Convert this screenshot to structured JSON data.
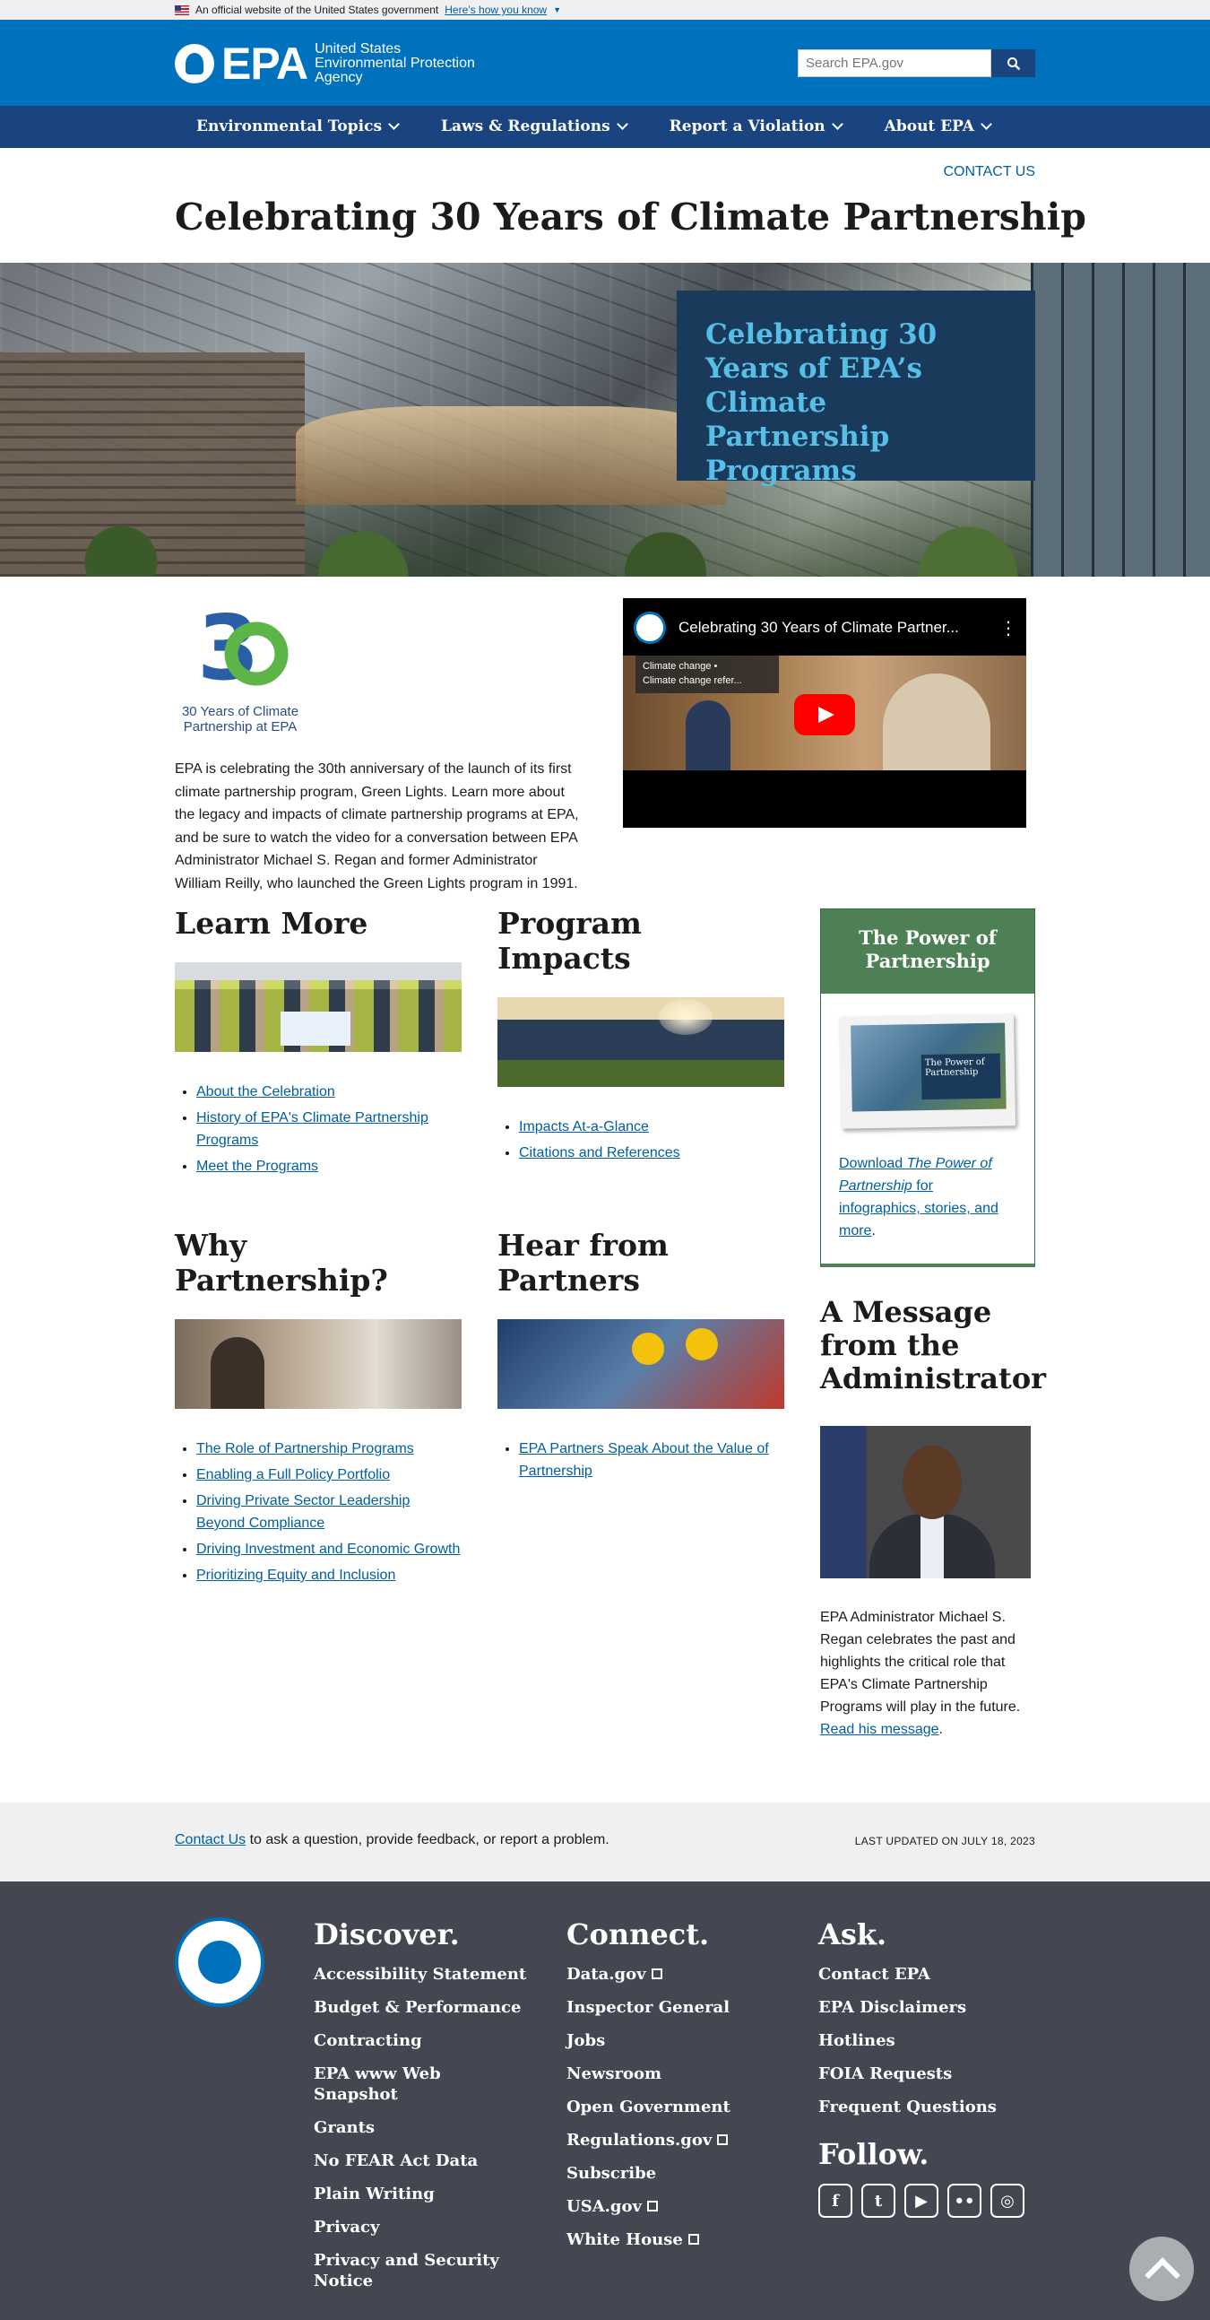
{
  "gov_banner": {
    "text": "An official website of the United States government",
    "link": "Here’s how you know"
  },
  "header": {
    "logo": "EPA",
    "logo_sub": [
      "United States",
      "Environmental Protection",
      "Agency"
    ],
    "search_placeholder": "Search EPA.gov"
  },
  "nav": [
    "Environmental Topics",
    "Laws & Regulations",
    "Report a Violation",
    "About EPA"
  ],
  "contact_link": "CONTACT US",
  "page_title": "Celebrating 30 Years of Climate Partnership",
  "hero_title": "Celebrating 30 Years of EPA’s Climate Partnership Programs",
  "badge": {
    "line1": "30 Years of Climate",
    "line2": "Partnership at EPA"
  },
  "intro": "EPA is celebrating the 30th anniversary of the launch of its first climate partnership program, Green Lights. Learn more about the legacy and impacts of climate partnership programs at EPA, and be sure to watch the video for a conversation between EPA Administrator Michael S. Regan and former Administrator William Reilly, who launched the Green Lights program in 1991.",
  "video": {
    "title": "Celebrating 30 Years of Climate Partner...",
    "playlist_1": "Climate change •",
    "playlist_2": "Climate change refer..."
  },
  "learn_more": {
    "title": "Learn More",
    "links": [
      "About the Celebration",
      "History of EPA's Climate Partnership Programs",
      "Meet the Programs"
    ]
  },
  "program_impacts": {
    "title": "Program Impacts",
    "links": [
      "Impacts At-a-Glance",
      "Citations and References"
    ]
  },
  "why_partnership": {
    "title": "Why Partnership?",
    "links": [
      "The Role of Partnership Programs",
      "Enabling a Full Policy Portfolio",
      "Driving Private Sector Leadership Beyond Compliance",
      "Driving Investment and Economic Growth",
      "Prioritizing Equity and Inclusion"
    ]
  },
  "hear_partners": {
    "title": "Hear from Partners",
    "links": [
      "EPA Partners Speak About the Value of Partnership"
    ]
  },
  "power": {
    "title": "The Power of Partnership",
    "thumb_label": "The Power of Partnership",
    "download": "Download",
    "doc": "The Power of Partnership",
    "rest": "for infographics, stories, and more",
    "period": "."
  },
  "message": {
    "title": "A Message from the Administrator",
    "text": "EPA Administrator Michael S. Regan celebrates the past and highlights the critical role that EPA's Climate Partnership Programs will play in the future.",
    "link": "Read his message",
    "period": "."
  },
  "contact_bar": {
    "link": "Contact Us",
    "text": "to ask a question, provide feedback, or report a problem.",
    "updated": "LAST UPDATED ON JULY 18, 2023"
  },
  "footer": {
    "discover": {
      "title": "Discover.",
      "links": [
        "Accessibility Statement",
        "Budget & Performance",
        "Contracting",
        "EPA www Web Snapshot",
        "Grants",
        "No FEAR Act Data",
        "Plain Writing",
        "Privacy",
        "Privacy and Security Notice"
      ]
    },
    "connect": {
      "title": "Connect.",
      "links": [
        "Data.gov",
        "Inspector General",
        "Jobs",
        "Newsroom",
        "Open Government",
        "Regulations.gov",
        "Subscribe",
        "USA.gov",
        "White House"
      ]
    },
    "ask": {
      "title": "Ask.",
      "links": [
        "Contact EPA",
        "EPA Disclaimers",
        "Hotlines",
        "FOIA Requests",
        "Frequent Questions"
      ]
    },
    "follow": {
      "title": "Follow.",
      "icons": [
        "facebook-icon",
        "twitter-icon",
        "youtube-icon",
        "flickr-icon",
        "instagram-icon"
      ]
    }
  }
}
